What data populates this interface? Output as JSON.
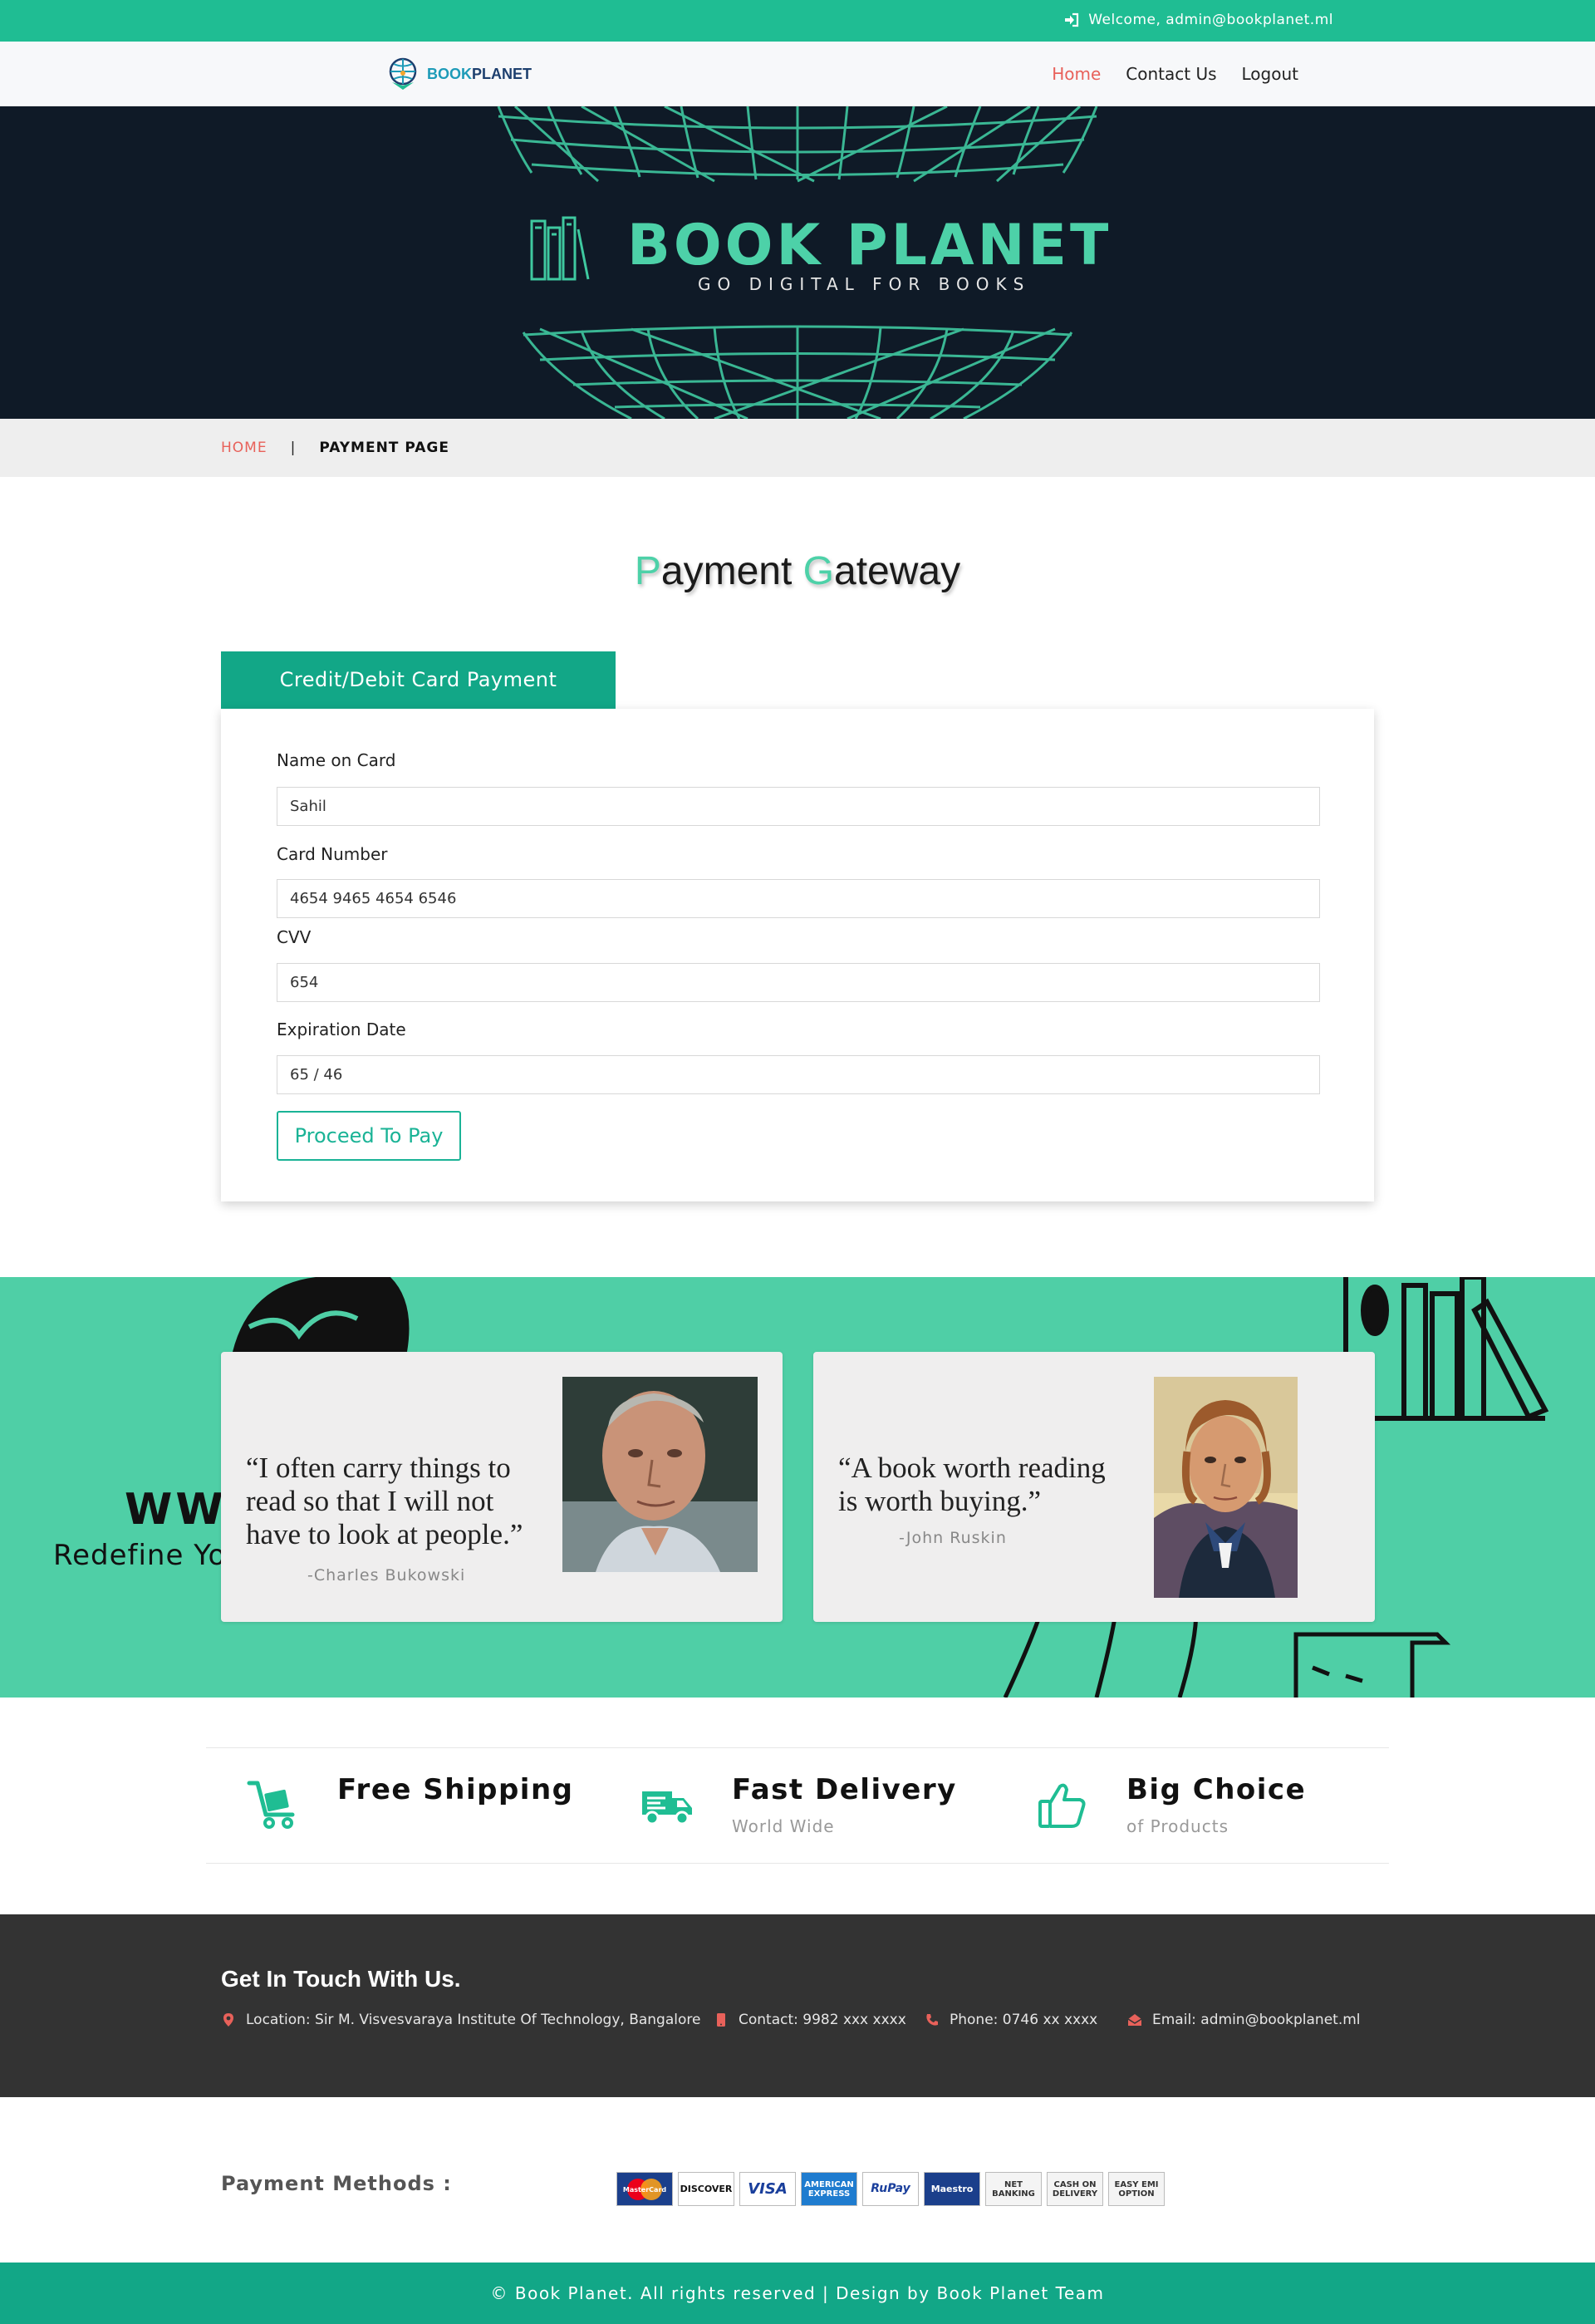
{
  "topbar": {
    "welcome": "Welcome, admin@bookplanet.ml"
  },
  "nav": {
    "brand_part1": "BOOK",
    "brand_part2": "PLANET",
    "links": [
      "Home",
      "Contact Us",
      "Logout"
    ]
  },
  "hero": {
    "title": "BOOK PLANET",
    "subtitle": "GO DIGITAL FOR BOOKS"
  },
  "breadcrumb": {
    "home": "HOME",
    "separator": "|",
    "current": "PAYMENT PAGE"
  },
  "payment": {
    "title_cap1": "P",
    "title_rest1": "ayment ",
    "title_cap2": "G",
    "title_rest2": "ateway",
    "tab_label": "Credit/Debit Card Payment",
    "fields": [
      {
        "label": "Name on Card",
        "value": "Sahil"
      },
      {
        "label": "Card Number",
        "value": "4654 9465 4654 6546"
      },
      {
        "label": "CVV",
        "value": "654"
      },
      {
        "label": "Expiration Date",
        "value": "65 / 46"
      }
    ],
    "button_label": "Proceed To Pay"
  },
  "quotes_band": {
    "bg_text_1": "WWW",
    "bg_text_2": "Redefine Yo",
    "quotes": [
      {
        "line1": "“I often carry things to",
        "line2": "read so that I will not",
        "line3": "have to look at people.”",
        "author": "-Charles Bukowski"
      },
      {
        "line1": "“A book worth reading",
        "line2": "is worth buying.”",
        "author": "-John Ruskin"
      }
    ]
  },
  "features": [
    {
      "title": "Free Shipping",
      "subtitle": "",
      "icon": "cart-icon"
    },
    {
      "title": "Fast Delivery",
      "subtitle": "World Wide",
      "icon": "truck-icon"
    },
    {
      "title": "Big Choice",
      "subtitle": "of Products",
      "icon": "thumbs-up-icon"
    }
  ],
  "contact": {
    "heading": "Get In Touch With Us.",
    "location": "Location: Sir M. Visvesvaraya Institute Of Technology, Bangalore",
    "contact": "Contact: 9982 xxx xxxx",
    "phone": "Phone: 0746 xx xxxx",
    "email": "Email: admin@bookplanet.ml"
  },
  "payment_methods": {
    "label": "Payment Methods :",
    "items": [
      "MasterCard",
      "DISCOVER",
      "VISA",
      "AMERICAN EXPRESS",
      "RuPay",
      "Maestro",
      "NET BANKING",
      "CASH ON DELIVERY",
      "EASY EMI OPTION"
    ]
  },
  "footer": {
    "copyright": "© Book Planet. All rights reserved | Design by Book Planet Team"
  },
  "colors": {
    "accent": "#1fbd93",
    "accent_dark": "#12a787",
    "quote_band": "#4fcfa6",
    "link_active": "#e8615a",
    "hero_bg": "#0f1a27",
    "contact_bg": "#333333"
  }
}
